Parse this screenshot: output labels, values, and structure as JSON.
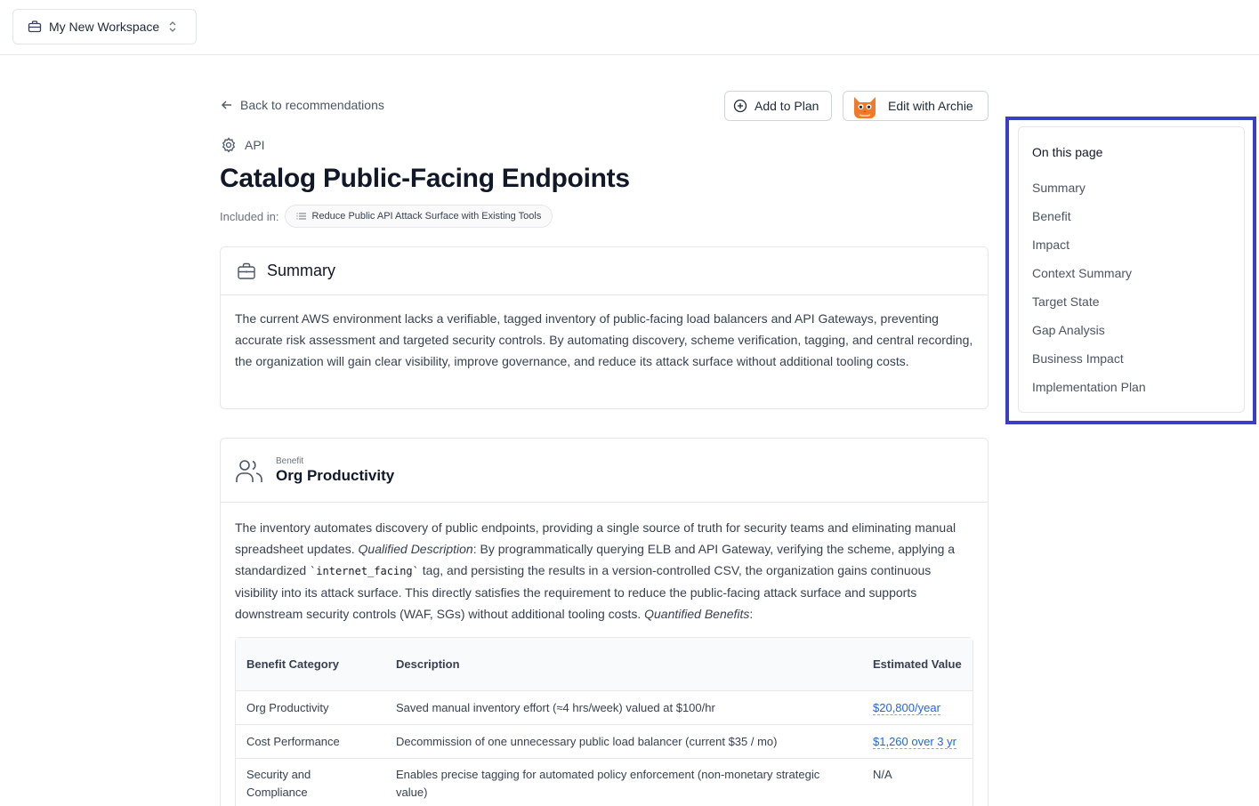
{
  "workspace": {
    "name": "My New Workspace"
  },
  "header": {
    "back_label": "Back to recommendations",
    "add_to_plan_label": "Add to Plan",
    "edit_label": "Edit with Archie",
    "category": "API",
    "title": "Catalog Public-Facing Endpoints",
    "included_label": "Included in:",
    "included_plan": "Reduce Public API Attack Surface with Existing Tools"
  },
  "summary": {
    "heading": "Summary",
    "text": "The current AWS environment lacks a verifiable, tagged inventory of public-facing load balancers and API Gateways, preventing accurate risk assessment and targeted security controls. By automating discovery, scheme verification, tagging, and central recording, the organization will gain clear visibility, improve governance, and reduce its attack surface without additional tooling costs."
  },
  "benefit": {
    "eyebrow": "Benefit",
    "heading": "Org Productivity",
    "text_1": "The inventory automates discovery of public endpoints, providing a single source of truth for security teams and eliminating manual spreadsheet updates. ",
    "qualified_label": "Qualified Description",
    "text_2": ": By programmatically querying ELB and API Gateway, verifying the scheme, applying a standardized ",
    "code": "`internet_facing`",
    "text_3": " tag, and persisting the results in a version-controlled CSV, the organization gains continuous visibility into its attack surface. This directly satisfies the requirement to reduce the public-facing attack surface and supports downstream security controls (WAF, SGs) without additional tooling costs. ",
    "quantified_label": "Quantified Benefits",
    "text_4": ":",
    "table": {
      "headers": [
        "Benefit Category",
        "Description",
        "Estimated Value"
      ],
      "rows": [
        {
          "category": "Org Productivity",
          "description": "Saved manual inventory effort (≈4 hrs/week) valued at $100/hr",
          "value": "$20,800/year"
        },
        {
          "category": "Cost Performance",
          "description": "Decommission of one unnecessary public load balancer (current $35 / mo)",
          "value": "$1,260 over 3 yr"
        },
        {
          "category": "Security and Compliance",
          "description": "Enables precise tagging for automated policy enforcement (non-monetary strategic value)",
          "value": "N/A"
        }
      ]
    }
  },
  "toc": {
    "title": "On this page",
    "items": [
      "Summary",
      "Benefit",
      "Impact",
      "Context Summary",
      "Target State",
      "Gap Analysis",
      "Business Impact",
      "Implementation Plan"
    ]
  },
  "colors": {
    "accent": "#3b3fc4",
    "link": "#2563eb"
  },
  "icons": [
    "briefcase-icon",
    "chevron-up-down-icon",
    "arrow-left-icon",
    "plus-circle-icon",
    "archie-avatar-icon",
    "gear-icon",
    "list-icon",
    "users-icon"
  ]
}
